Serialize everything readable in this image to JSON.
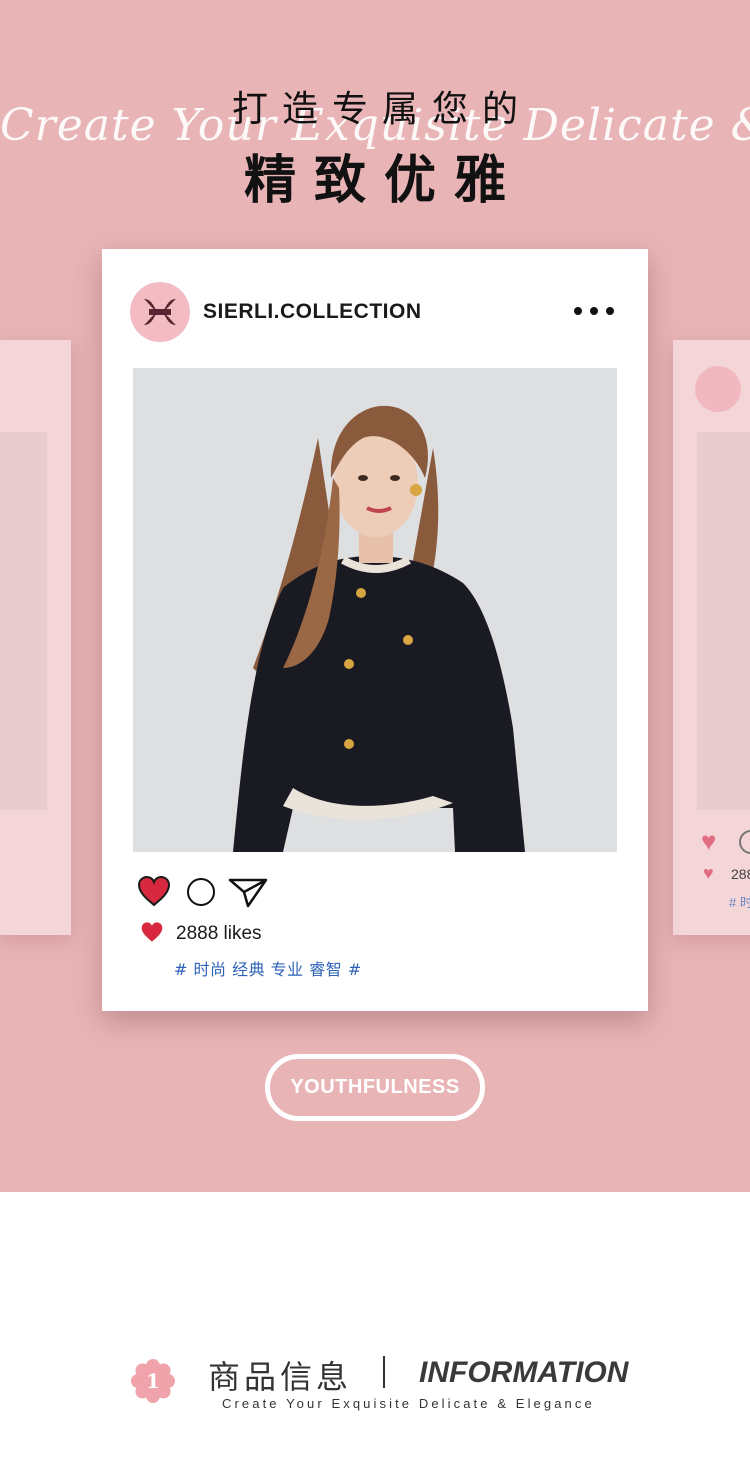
{
  "header": {
    "title_line1": "打造专属您的",
    "title_line2": "精致优雅",
    "script_text": "Create Your Exquisite Delicate & Elegance"
  },
  "post": {
    "handle": "SIERLI.COLLECTION",
    "avatar_icon": "brand-logo-icon",
    "more_icon": "more-dots-icon",
    "actions": [
      "heart-icon",
      "comment-icon",
      "share-icon"
    ],
    "likes": "2888 likes",
    "tags": "# 时尚 经典 专业 睿智 #"
  },
  "ghost_card_right": {
    "likes": "288",
    "tag": "# 时"
  },
  "cta": {
    "label": "YOUTHFULNESS"
  },
  "info": {
    "badge_number": "1",
    "title_cn": "商品信息",
    "title_en": "INFORMATION",
    "subtitle": "Create Your Exquisite Delicate & Elegance"
  },
  "colors": {
    "background_pink": "#e8b4b6",
    "heart_red": "#d8283f",
    "tag_blue": "#2e63b8",
    "badge_pink": "#f0a3ab"
  }
}
